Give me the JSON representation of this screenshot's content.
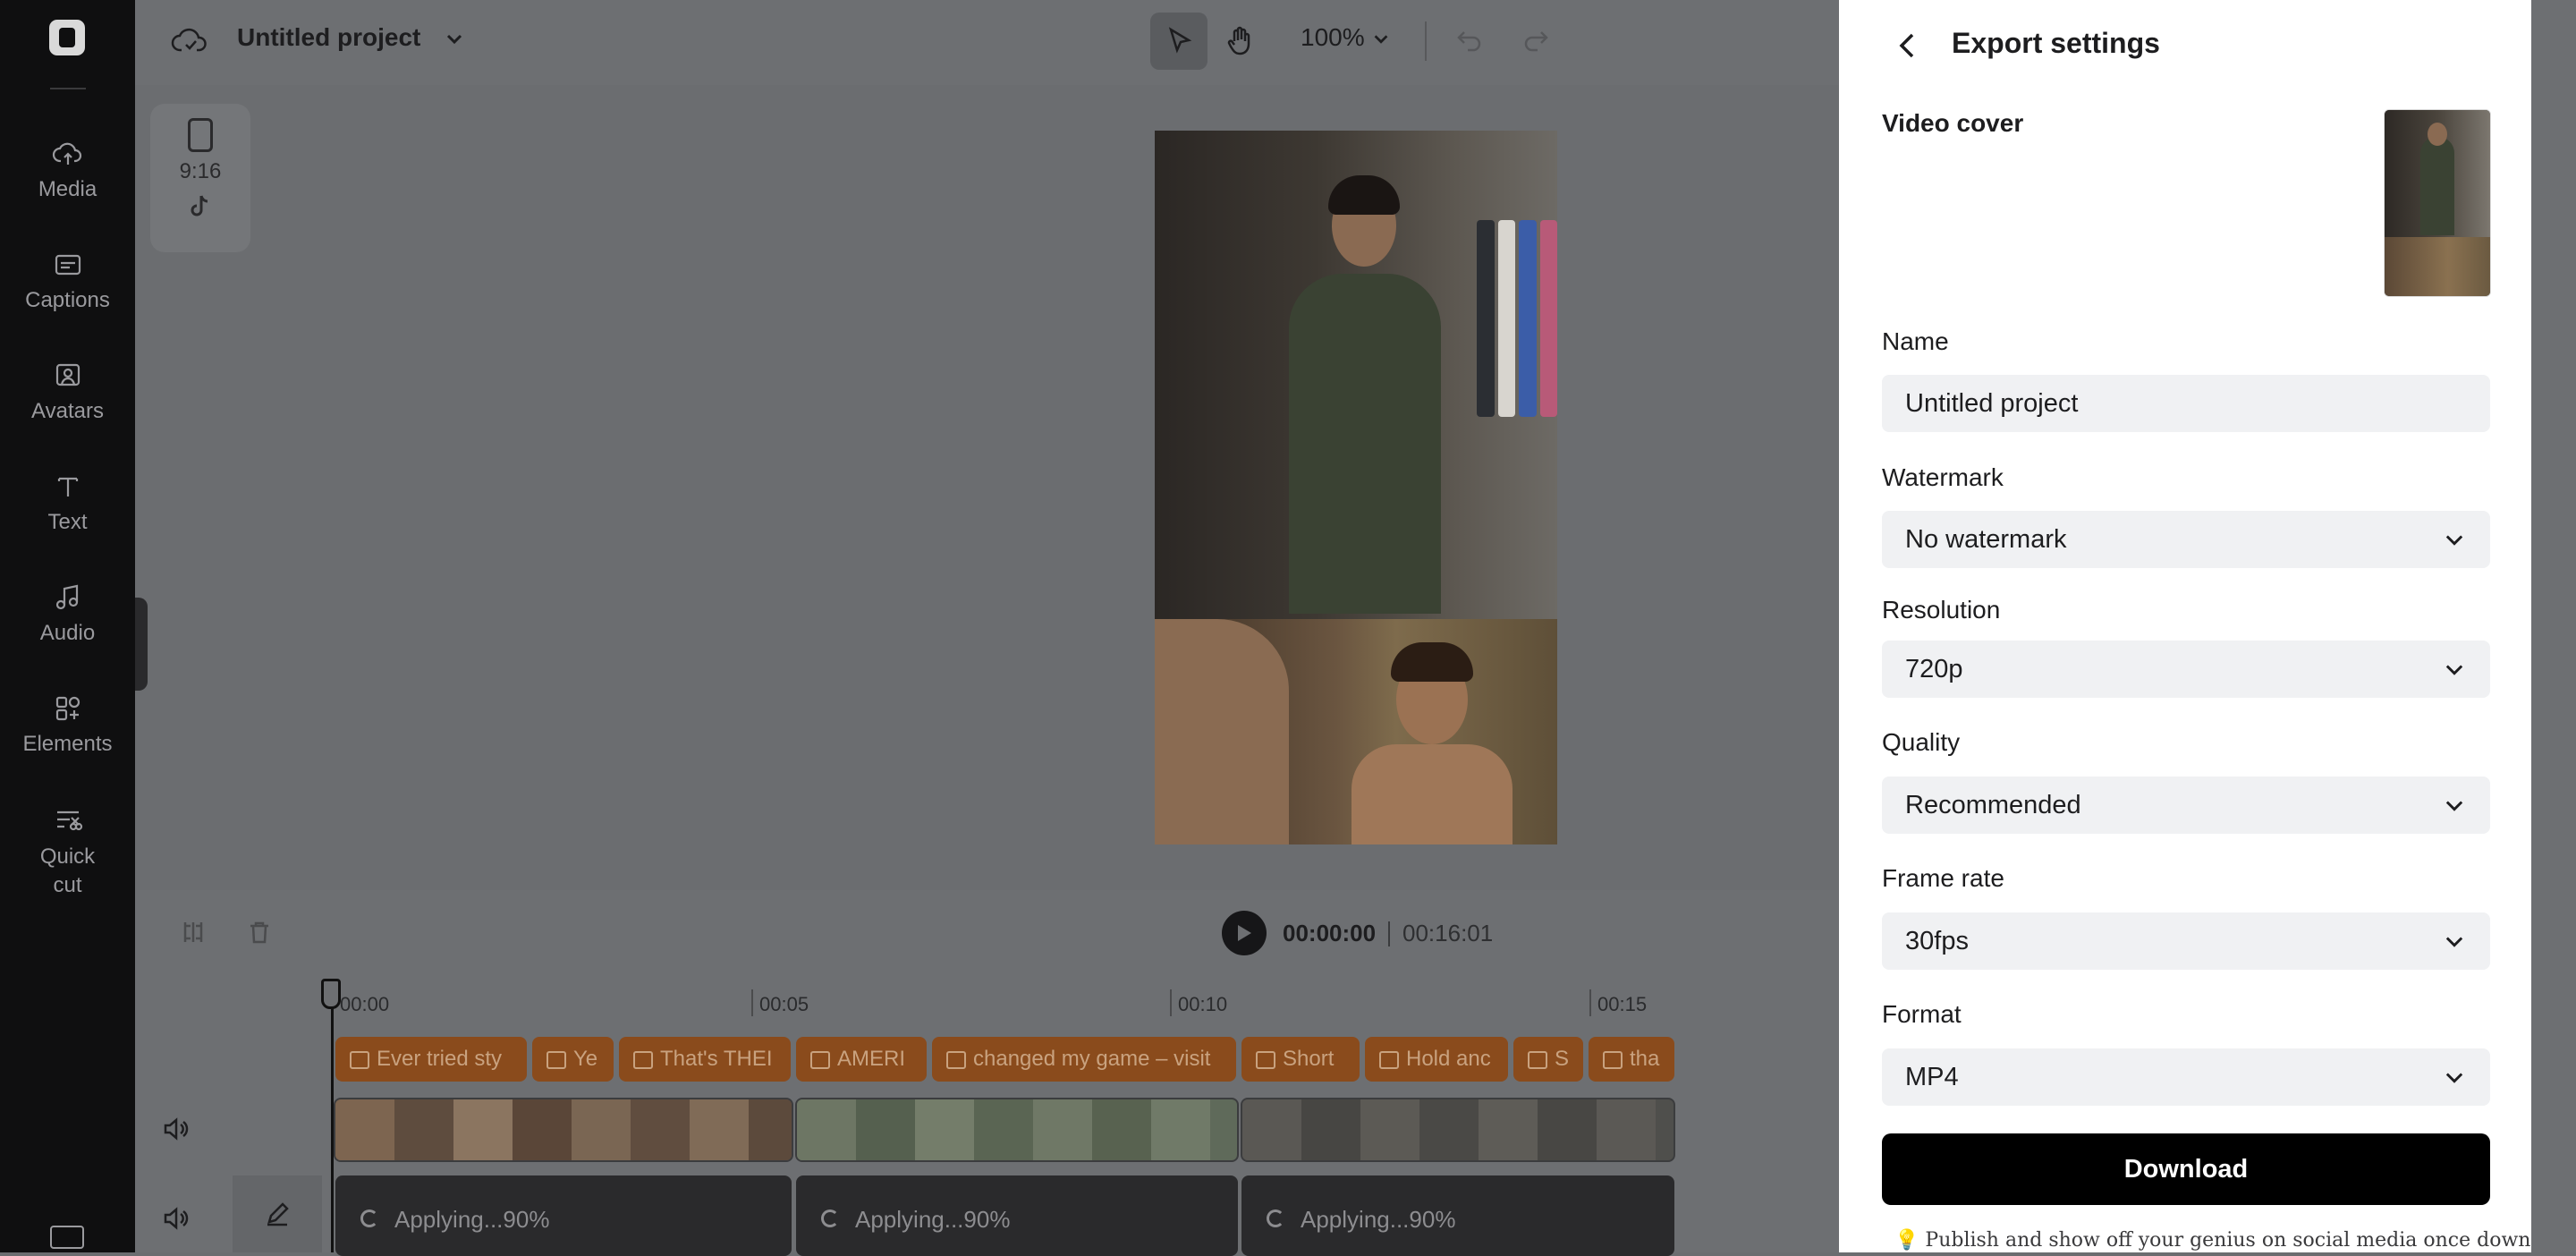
{
  "sidebar": {
    "items": [
      {
        "label": "Media",
        "icon": "cloud-upload-icon"
      },
      {
        "label": "Captions",
        "icon": "captions-icon"
      },
      {
        "label": "Avatars",
        "icon": "avatar-icon"
      },
      {
        "label": "Text",
        "icon": "text-icon"
      },
      {
        "label": "Audio",
        "icon": "music-note-icon"
      },
      {
        "label": "Elements",
        "icon": "elements-icon"
      },
      {
        "label": "Quick",
        "icon": "scissors-icon"
      }
    ],
    "quick_cut_line2": "cut"
  },
  "header": {
    "project_title": "Untitled project",
    "zoom": "100%"
  },
  "canvas": {
    "aspect_ratio": "9:16"
  },
  "playback": {
    "current_time": "00:00:00",
    "total_time": "00:16:01"
  },
  "timeline": {
    "ruler": [
      "00:00",
      "00:05",
      "00:10",
      "00:15"
    ],
    "captions": [
      "Ever tried sty",
      "Ye",
      "That's THEI",
      "AMERI",
      "changed my game – visit",
      "Short",
      "Hold anc",
      "S",
      "tha"
    ],
    "applying": [
      "Applying...90%",
      "Applying...90%",
      "Applying...90%"
    ]
  },
  "export": {
    "title": "Export settings",
    "video_cover_label": "Video cover",
    "name_label": "Name",
    "name_value": "Untitled project",
    "watermark_label": "Watermark",
    "watermark_value": "No watermark",
    "resolution_label": "Resolution",
    "resolution_value": "720p",
    "quality_label": "Quality",
    "quality_value": "Recommended",
    "frame_rate_label": "Frame rate",
    "frame_rate_value": "30fps",
    "format_label": "Format",
    "format_value": "MP4",
    "download_label": "Download",
    "tip": "💡 Publish and show off your genius on social media once downloaded."
  },
  "colors": {
    "caption_clip": "#8a4b1c",
    "download_button": "#000000",
    "overlay": "#6b6d70"
  }
}
